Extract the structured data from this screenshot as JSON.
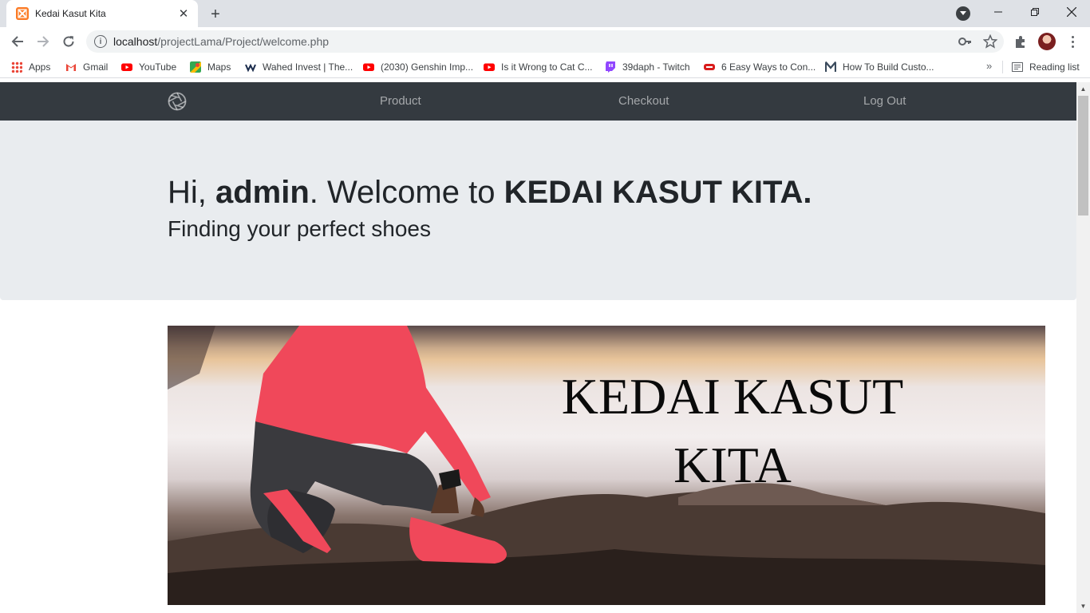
{
  "browser": {
    "tab_title": "Kedai Kasut Kita",
    "new_tab_icon": "+",
    "url_host": "localhost",
    "url_path": "/projectLama/Project/welcome.php",
    "bookmarks": [
      {
        "label": "Apps",
        "icon": "apps-grid-icon"
      },
      {
        "label": "Gmail",
        "icon": "gmail-icon"
      },
      {
        "label": "YouTube",
        "icon": "youtube-icon"
      },
      {
        "label": "Maps",
        "icon": "maps-icon"
      },
      {
        "label": "Wahed Invest | The...",
        "icon": "wahed-icon"
      },
      {
        "label": "(2030) Genshin Imp...",
        "icon": "youtube-icon"
      },
      {
        "label": "Is it Wrong to Cat C...",
        "icon": "youtube-icon"
      },
      {
        "label": "39daph - Twitch",
        "icon": "twitch-icon"
      },
      {
        "label": "6 Easy Ways to Con...",
        "icon": "bookmark-red-icon"
      },
      {
        "label": "How To Build Custo...",
        "icon": "medium-icon"
      }
    ],
    "more_bookmarks": "»",
    "reading_list": "Reading list"
  },
  "navbar": {
    "links": [
      "Product",
      "Checkout",
      "Log Out"
    ]
  },
  "jumbotron": {
    "title_prefix": "Hi, ",
    "title_user": "admin",
    "title_suffix": ". Welcome to ",
    "title_store": "KEDAI KASUT KITA.",
    "subtitle": "Finding your perfect shoes"
  },
  "banner": {
    "line1": "KEDAI KASUT",
    "line2": "KITA"
  },
  "colors": {
    "navbar_bg": "#343a40",
    "jumbotron_bg": "#e9ecef",
    "accent_red": "#f0485a"
  }
}
